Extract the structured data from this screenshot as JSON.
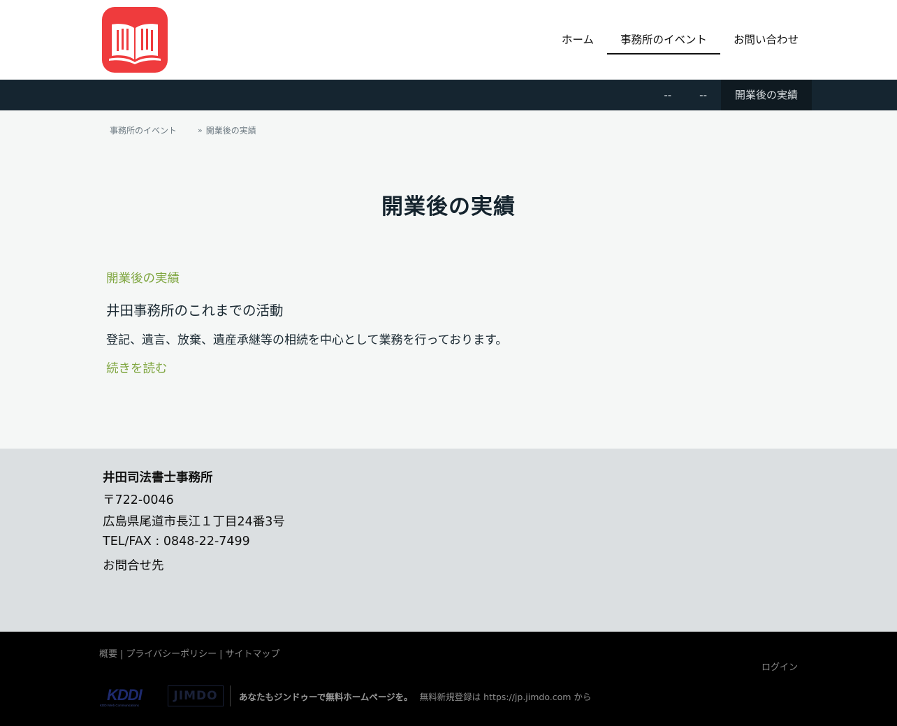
{
  "nav": {
    "items": [
      {
        "label": "ホーム",
        "active": false
      },
      {
        "label": "事務所のイベント",
        "active": true
      },
      {
        "label": "お問い合わせ",
        "active": false
      }
    ]
  },
  "subnav": {
    "items": [
      {
        "label": "--",
        "active": false
      },
      {
        "label": "--",
        "active": false
      },
      {
        "label": "開業後の実績",
        "active": true
      }
    ]
  },
  "breadcrumb": {
    "parent": "事務所のイベント",
    "separator": "»",
    "current": "開業後の実績"
  },
  "main": {
    "title": "開業後の実績",
    "post_link": "開業後の実績",
    "post_heading": "井田事務所のこれまでの活動",
    "post_text": "登記、遺言、放棄、遺産承継等の相続を中心として業務を行っております。",
    "read_more": "続きを読む"
  },
  "footer_info": {
    "name": "井田司法書士事務所",
    "postal": "〒722-0046",
    "address": "広島県尾道市長江１丁目24番3号",
    "tel": "TEL/FAX : 0848-22-7499",
    "contact": "お問合せ先"
  },
  "bottom": {
    "links": [
      "概要",
      "プライバシーポリシー",
      "サイトマップ"
    ],
    "link_separator": "|",
    "login": "ログイン",
    "kddi_text": "KDDI",
    "kddi_sub": "KDDI Web Communications",
    "jimdo_text": "JIMDO",
    "promo_strong": "あなたもジンドゥーで無料ホームページを。",
    "promo_text": "無料新規登録は",
    "promo_url": "https://jp.jimdo.com",
    "promo_suffix": "から"
  },
  "colors": {
    "logo_red": "#ef3b3d",
    "subnav_bg": "#152530",
    "accent_green": "#7fa640",
    "footer_info_bg": "#dbdfe1",
    "bottom_bg": "#000000"
  },
  "icons": {
    "logo": "open-book-icon"
  }
}
